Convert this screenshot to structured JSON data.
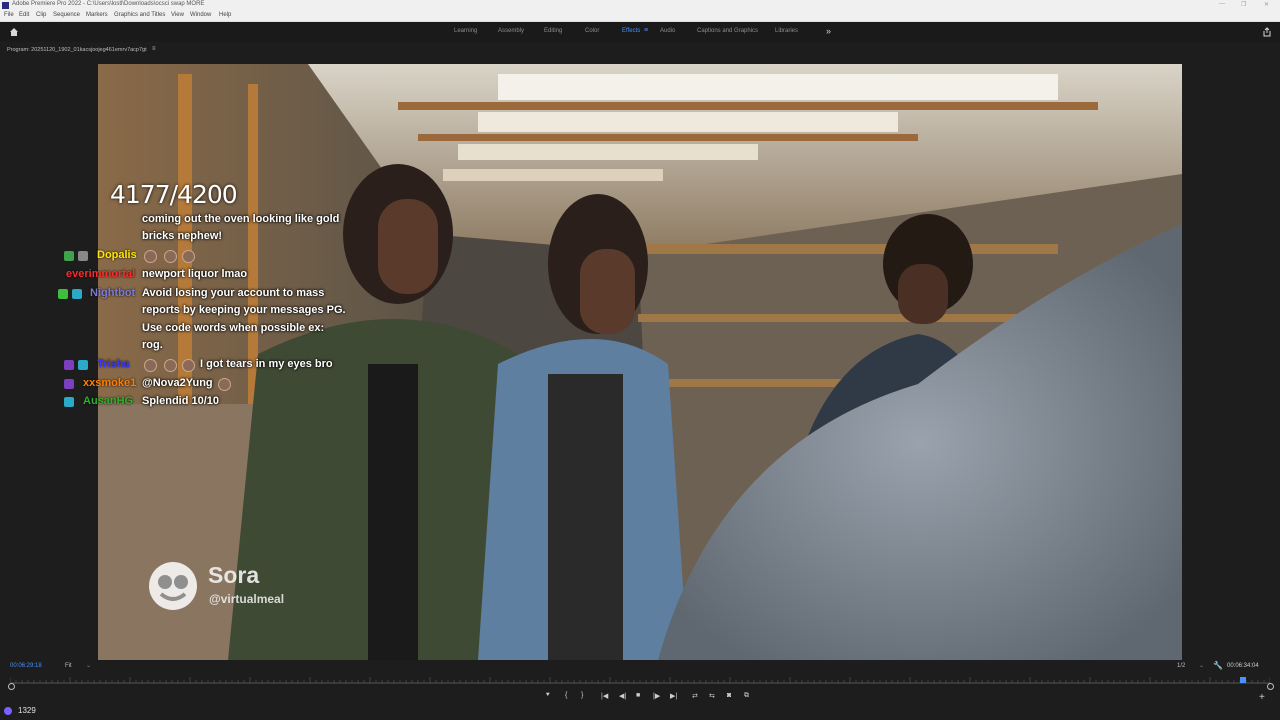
{
  "window": {
    "title": "Adobe Premiere Pro 2022 - C:\\Users\\lostl\\Downloads\\ocsci swap MORE",
    "controls": [
      "—",
      "❐",
      "✕"
    ]
  },
  "menu": [
    "File",
    "Edit",
    "Clip",
    "Sequence",
    "Markers",
    "Graphics and Titles",
    "View",
    "Window",
    "Help"
  ],
  "workspaces": {
    "tabs": [
      "Learning",
      "Assembly",
      "Editing",
      "Color",
      "Effects",
      "Audio",
      "Captions and Graphics",
      "Libraries"
    ],
    "active": "Effects",
    "menu_glyph": "≡",
    "more_glyph": "»"
  },
  "program": {
    "title": "Program: 20251120_1902_01kacsjoojeg461emrv7acp7gt",
    "menu_glyph": "≡"
  },
  "overlay": {
    "counter": "4177/4200",
    "chat": [
      {
        "name": "",
        "lines": [
          "coming out the oven looking like gold",
          "bricks nephew!"
        ],
        "name_color": "#00ff7f"
      },
      {
        "name": "Dopalis",
        "lines": [
          ""
        ],
        "name_color": "#ffe600"
      },
      {
        "name": "everimmortal",
        "lines": [
          "newport liquor lmao"
        ],
        "name_color": "#ff2a2a"
      },
      {
        "name": "Nightbot",
        "lines": [
          "Avoid losing your account to mass",
          "reports by keeping your messages PG.",
          "Use code words when possible ex:",
          "rog."
        ],
        "name_color": "#7b7bd6"
      },
      {
        "name": "Trisha",
        "lines": [
          "I got tears in my eyes bro"
        ],
        "name_color": "#3b3bff"
      },
      {
        "name": "xxsmoke1",
        "lines": [
          "@Nova2Yung"
        ],
        "name_color": "#ff7f00"
      },
      {
        "name": "AusanHG",
        "lines": [
          "Splendid 10/10"
        ],
        "name_color": "#2fb02f"
      }
    ],
    "watermark": {
      "brand": "Sora",
      "handle": "@virtualmeal"
    }
  },
  "monitor": {
    "timecode_current": "00:06:29:18",
    "fit": "Fit",
    "resolution": "1/2",
    "timecode_duration": "00:06:34:04",
    "playhead_fraction": 0.988
  },
  "transport": {
    "buttons": [
      "marker",
      "mark-in",
      "mark-out",
      "go-to-in",
      "step-back",
      "stop",
      "step-forward",
      "go-to-out",
      "insert",
      "overwrite",
      "export-frame",
      "comparison-view"
    ]
  },
  "status": {
    "count": "1329"
  },
  "colors": {
    "accent": "#4a90ff",
    "background": "#1d1d1d"
  },
  "icons": [
    "home-icon",
    "share-icon",
    "wrench-icon",
    "add-icon",
    "more-icon"
  ]
}
